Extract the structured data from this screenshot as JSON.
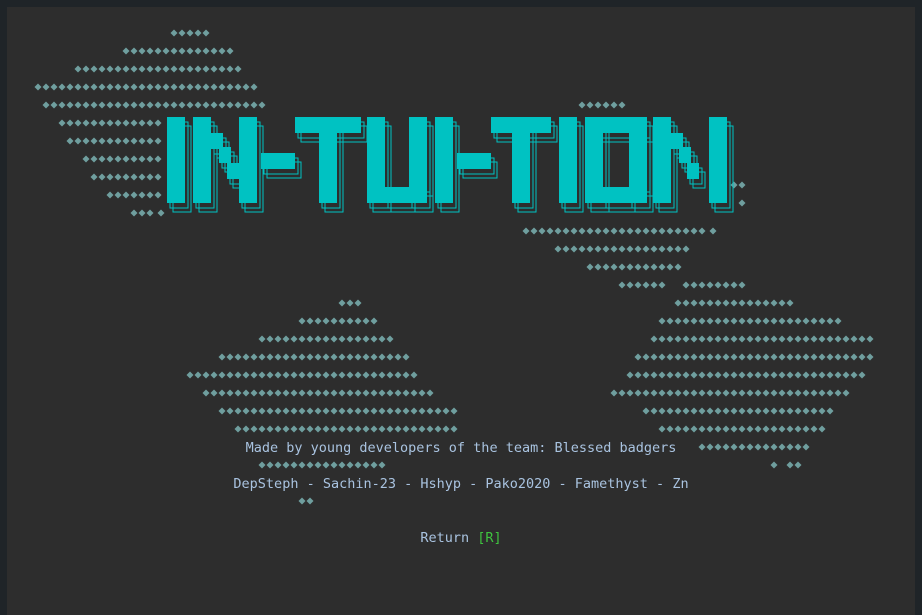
{
  "app": {
    "title": "IN-TUI-TION",
    "made_by": "Made by young developers of the team: Blessed badgers",
    "credits": "DepSteph - Sachin-23 - Hshyp - Pako2020 - Famethyst - Zn",
    "return_label": "Return",
    "return_key": "[R]"
  },
  "colors": {
    "background": "#2d2d2d",
    "diamond": "#6f9e9e",
    "logo": "#00c2c2",
    "text": "#a9c3e0",
    "key": "#3fc23f"
  },
  "icons": {
    "diamond": "diamond-icon"
  }
}
